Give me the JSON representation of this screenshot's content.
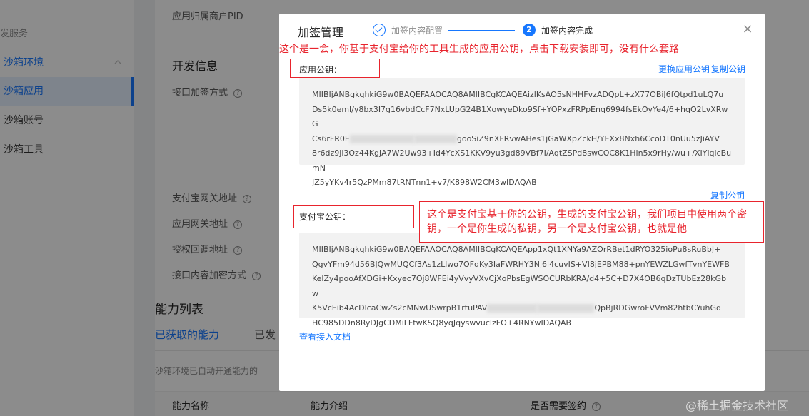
{
  "sidebar": {
    "section": "发服务",
    "group": "沙箱环境",
    "items": [
      "沙箱应用",
      "沙箱账号",
      "沙箱工具"
    ]
  },
  "main": {
    "merchant_pid_label": "应用归属商户PID",
    "dev_info_heading": "开发信息",
    "sign_method_label": "接口加签方式",
    "alipay_gateway_label": "支付宝网关地址",
    "app_gateway_label": "应用网关地址",
    "auth_callback_label": "授权回调地址",
    "encrypt_method_label": "接口内容加密方式",
    "ability_list_heading": "能力列表",
    "tab_acquired": "已获取的能力",
    "tab_other": "已发",
    "sandbox_note": "沙箱环境已自动开通能力的",
    "col_name": "能力名称",
    "col_intro": "能力介绍",
    "col_need_sign": "是否需要签约"
  },
  "modal": {
    "title": "加签管理",
    "step1": "加签内容配置",
    "step2_num": "2",
    "step2": "加签内容完成",
    "close": "×",
    "annotation_top": "这个是一会，你基于支付宝给你的工具生成的应用公钥，点击下载安装即可，没有什么套路",
    "app_public_key_label": "应用公钥：",
    "replace_key_link": "更换应用公钥",
    "copy_key_link": "复制公钥",
    "app_key_lines": [
      "MIIBIjANBgkqhkiG9w0BAQEFAAOCAQ8AMIIBCgKCAQEAizlKsAO5sNHHFvzADQpL+zX77OBiJ6fQtpd1uLQ7u",
      "Ds5k0eml/y8bx3I7g16vbdCcF7NxLUpG24B1XowyeDko9Sf+YOPxzFRPpEnq6994fsEkOyYe4/6+hqO2LvXRwG",
      "Cs6rFR0E",
      "gooSiZ9nXFRvwAHes1jGaWXpZckH/YEXx8Nxh6CcoDT0nUu5zJiAYV",
      "8r6dz9ji3Oz44KgjA7W2Uw93+Id4YcXS1KKV9yu3gd89VBf7I/AqtZSPd8swCOC8K1Hin5x9rHy/wu+/XIYlqicBumN",
      "JZ5yYKv4r5QzPMm87tRNTnn1+v7/K898W2CM3wIDAQAB"
    ],
    "copy_alipay_key_link": "复制公钥",
    "alipay_public_key_label": "支付宝公钥：",
    "annotation_mid": "这个是支付宝基于你的公钥，生成的支付宝公钥，我们项目中使用两个密钥，一个是你生成的私钥，另一个是支付宝公钥，也就是他",
    "alipay_key_lines": [
      "MIIBIjANBgkqhkiG9w0BAQEFAAOCAQ8AMIIBCgKCAQEApp1xQt1XNYa9AZOrRBet1dRYO325ioPu8sRuBbJ+",
      "QgvYFm94d56BJQwMUQCf3As1zLlwo7OFqKy3IaFWRHY3Nj6l4cuvIS+VI8jEPBM88+pnYEWZLGwfTvnYEWFB",
      "KelZy4pooAfXDGi+Kxyec7Oj8WFEi4yVvyVXvCjXoPbsEgWSOCURbKRA/d4+5C+D7X4OB6qDzTUbEz28kGbw",
      "K5VcEib4AcDlcaCwZs2cMNwUSwrpB1rtuPAV",
      "QpBjRDGwroFVVm82htbCYuhGd",
      "HC985DDn8RyDJgCDMiLFtwKSQ8yqJqyswvuclzFO+4RNYwIDAQAB"
    ],
    "doc_link": "查看接入文档"
  },
  "watermark": "@稀土掘金技术社区"
}
